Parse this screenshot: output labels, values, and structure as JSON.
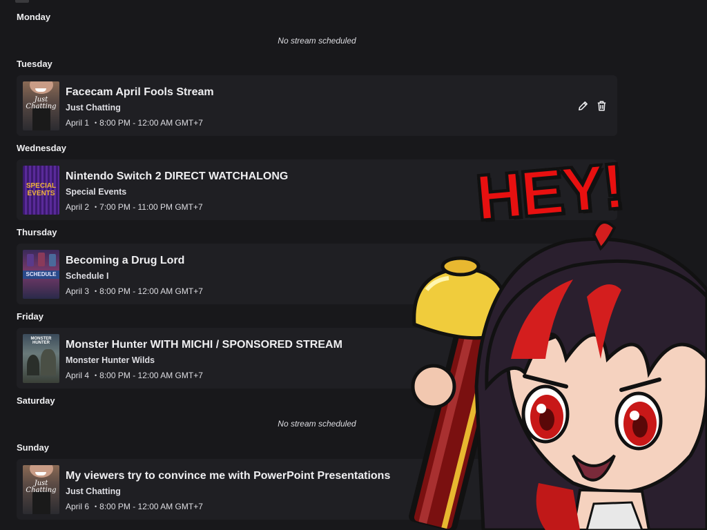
{
  "days": {
    "monday": {
      "label": "Monday",
      "empty_text": "No stream scheduled"
    },
    "tuesday": {
      "label": "Tuesday"
    },
    "wednesday": {
      "label": "Wednesday"
    },
    "thursday": {
      "label": "Thursday"
    },
    "friday": {
      "label": "Friday"
    },
    "saturday": {
      "label": "Saturday",
      "empty_text": "No stream scheduled"
    },
    "sunday": {
      "label": "Sunday"
    }
  },
  "streams": [
    {
      "title": "Facecam April Fools Stream",
      "category": "Just Chatting",
      "date": "April 1",
      "time": "8:00 PM - 12:00 AM GMT+7",
      "thumb_text": "Just Chatting"
    },
    {
      "title": "Nintendo Switch 2 DIRECT WATCHALONG",
      "category": "Special Events",
      "date": "April 2",
      "time": "7:00 PM - 11:00 PM GMT+7",
      "thumb_text": "SPECIAL EVENTS"
    },
    {
      "title": "Becoming a Drug Lord",
      "category": "Schedule I",
      "date": "April 3",
      "time": "8:00 PM - 12:00 AM GMT+7",
      "thumb_text": "SCHEDULE"
    },
    {
      "title": "Monster Hunter WITH MICHI / SPONSORED STREAM",
      "category": "Monster Hunter Wilds",
      "date": "April 4",
      "time": "8:00 PM - 12:00 AM GMT+7",
      "thumb_text": "MONSTER HUNTER"
    },
    {
      "title": "My viewers try to convince me with PowerPoint Presentations",
      "category": "Just Chatting",
      "date": "April 6",
      "time": "8:00 PM - 12:00 AM GMT+7",
      "thumb_text": "Just Chatting"
    }
  ],
  "meta_separator": "•",
  "icons": {
    "edit": "pencil-icon",
    "delete": "trash-icon"
  },
  "overlay": {
    "text": "HEY!",
    "text_color": "#e81010",
    "hair_colors": [
      "#2a1f2e",
      "#d41e1e"
    ],
    "eye_color": "#c81818"
  },
  "colors": {
    "background": "#18181b",
    "card": "#1f1f23",
    "text": "#efeff1"
  }
}
